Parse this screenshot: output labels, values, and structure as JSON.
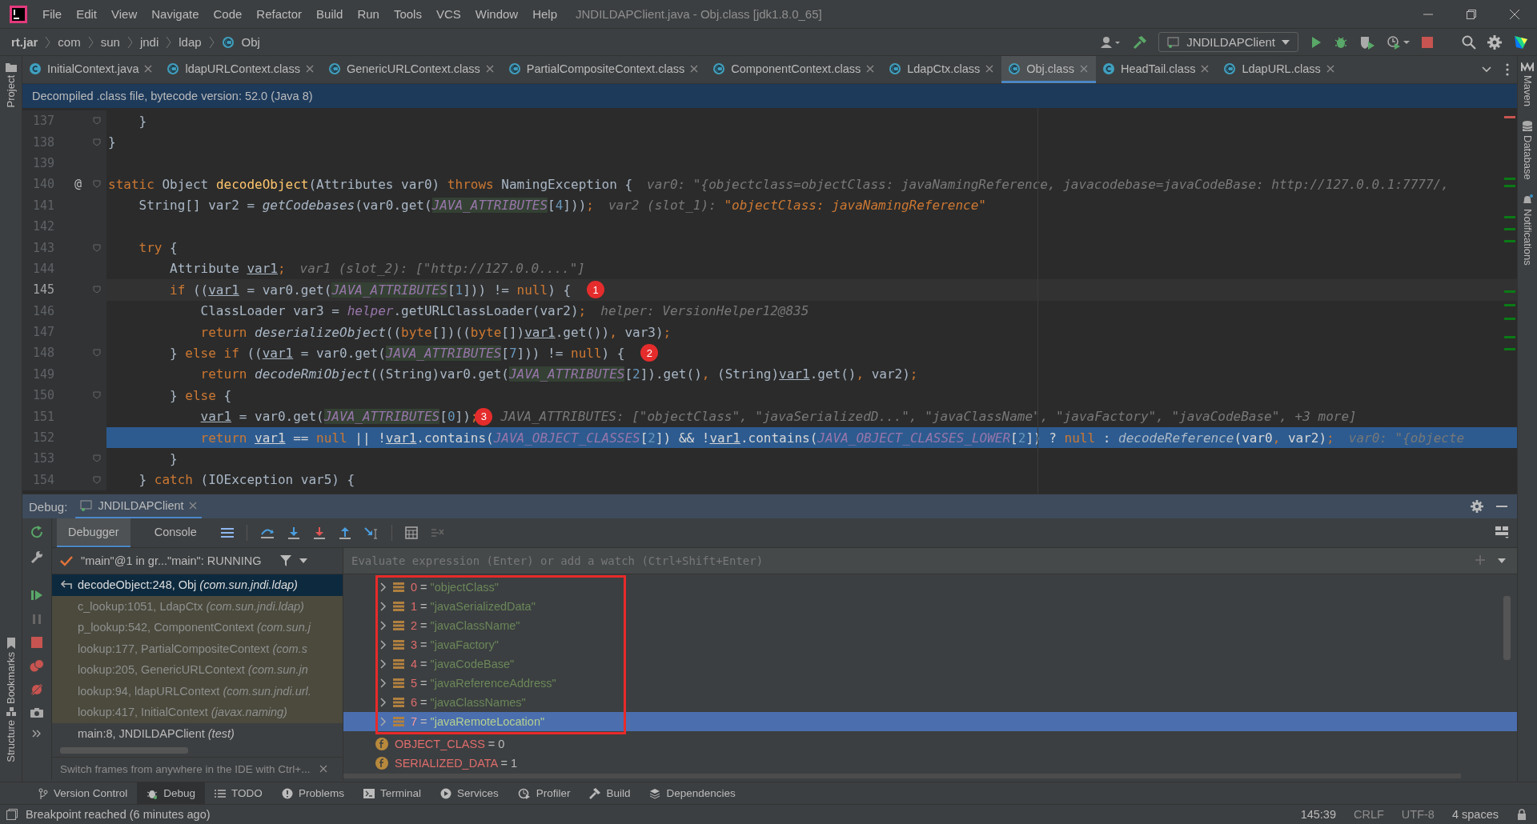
{
  "menu": [
    "File",
    "Edit",
    "View",
    "Navigate",
    "Code",
    "Refactor",
    "Build",
    "Run",
    "Tools",
    "VCS",
    "Window",
    "Help"
  ],
  "window_title": "JNDILDAPClient.java - Obj.class [jdk1.8.0_65]",
  "breadcrumb": [
    "rt.jar",
    "com",
    "sun",
    "jndi",
    "ldap",
    "Obj"
  ],
  "run_config": "JNDILDAPClient",
  "editor_tabs": [
    {
      "label": "InitialContext.java",
      "selected": false,
      "kind": "java"
    },
    {
      "label": "ldapURLContext.class",
      "selected": false,
      "kind": "compiled"
    },
    {
      "label": "GenericURLContext.class",
      "selected": false,
      "kind": "compiled"
    },
    {
      "label": "PartialCompositeContext.class",
      "selected": false,
      "kind": "compiled"
    },
    {
      "label": "ComponentContext.class",
      "selected": false,
      "kind": "compiled"
    },
    {
      "label": "LdapCtx.class",
      "selected": false,
      "kind": "compiled"
    },
    {
      "label": "Obj.class",
      "selected": true,
      "kind": "compiled"
    },
    {
      "label": "HeadTail.class",
      "selected": false,
      "kind": "java"
    },
    {
      "label": "LdapURL.class",
      "selected": false,
      "kind": "compiled"
    }
  ],
  "banner": "Decompiled .class file, bytecode version: 52.0 (Java 8)",
  "code_lines": [
    {
      "number": "137",
      "caret_line": false,
      "execution_point": false,
      "fold": true,
      "tokens": [
        {
          "text": "    }",
          "kind": "p"
        }
      ]
    },
    {
      "number": "138",
      "caret_line": false,
      "execution_point": false,
      "fold": true,
      "tokens": [
        {
          "text": "}",
          "kind": "p"
        }
      ]
    },
    {
      "number": "139",
      "caret_line": false,
      "execution_point": false,
      "fold": false
    },
    {
      "number": "140",
      "caret_line": false,
      "execution_point": false,
      "fold": true,
      "gutter_mark": "@",
      "tokens": [
        {
          "text": "static ",
          "kind": "k"
        },
        {
          "text": "Object ",
          "kind": "p"
        },
        {
          "text": "decodeObject",
          "kind": "d"
        },
        {
          "text": "(Attributes var0) ",
          "kind": "p"
        },
        {
          "text": "throws ",
          "kind": "k"
        },
        {
          "text": "NamingException {",
          "kind": "p"
        },
        {
          "text": "var0: \"{objectclass=objectClass: javaNamingReference, javacodebase=javaCodeBase: http://127.0.0.1:7777/,",
          "kind": "h"
        }
      ]
    },
    {
      "number": "141",
      "caret_line": false,
      "execution_point": false,
      "fold": false,
      "tokens": [
        {
          "text": "    String[] var2 = ",
          "kind": "p"
        },
        {
          "text": "getCodebases",
          "kind": "s"
        },
        {
          "text": "(var0.get(",
          "kind": "p"
        },
        {
          "text": "JAVA_ATTRIBUTES",
          "kind": "F"
        },
        {
          "text": "[",
          "kind": "p"
        },
        {
          "text": "4",
          "kind": "n"
        },
        {
          "text": "]))",
          "kind": "p"
        },
        {
          "text": ";",
          "kind": "k"
        },
        {
          "text": "var2 (slot_1): ",
          "kind": "h"
        },
        {
          "text": "\"objectClass: javaNamingReference\"",
          "kind": "hs"
        }
      ]
    },
    {
      "number": "142",
      "caret_line": false,
      "execution_point": false,
      "fold": false
    },
    {
      "number": "143",
      "caret_line": false,
      "execution_point": false,
      "fold": true,
      "tokens": [
        {
          "text": "    try ",
          "kind": "k"
        },
        {
          "text": "{",
          "kind": "p"
        }
      ]
    },
    {
      "number": "144",
      "caret_line": false,
      "execution_point": false,
      "fold": false,
      "tokens": [
        {
          "text": "        Attribute ",
          "kind": "p"
        },
        {
          "text": "var1",
          "kind": "v"
        },
        {
          "text": ";",
          "kind": "k"
        },
        {
          "text": "var1 (slot_2): [\"http://127.0.0....\"]",
          "kind": "h"
        }
      ]
    },
    {
      "number": "145",
      "caret_line": true,
      "execution_point": false,
      "fold": true,
      "tokens": [
        {
          "text": "        if ",
          "kind": "k"
        },
        {
          "text": "((",
          "kind": "p"
        },
        {
          "text": "var1",
          "kind": "v"
        },
        {
          "text": " = var0.get(",
          "kind": "p"
        },
        {
          "text": "JAVA_ATTRIBUTES",
          "kind": "F"
        },
        {
          "text": "[",
          "kind": "p"
        },
        {
          "text": "1",
          "kind": "n"
        },
        {
          "text": "])) != ",
          "kind": "p"
        },
        {
          "text": "null",
          "kind": "k"
        },
        {
          "text": ") {",
          "kind": "p"
        },
        {
          "text": "1",
          "kind": "badge"
        }
      ]
    },
    {
      "number": "146",
      "caret_line": false,
      "execution_point": false,
      "fold": false,
      "tokens": [
        {
          "text": "            ClassLoader var3 = ",
          "kind": "p"
        },
        {
          "text": "helper",
          "kind": "g"
        },
        {
          "text": ".getURLClassLoader(var2)",
          "kind": "p"
        },
        {
          "text": ";",
          "kind": "k"
        },
        {
          "text": "helper: VersionHelper12@835",
          "kind": "h"
        }
      ]
    },
    {
      "number": "147",
      "caret_line": false,
      "execution_point": false,
      "fold": false,
      "tokens": [
        {
          "text": "            return ",
          "kind": "k"
        },
        {
          "text": "deserializeObject",
          "kind": "s"
        },
        {
          "text": "((",
          "kind": "p"
        },
        {
          "text": "byte",
          "kind": "k"
        },
        {
          "text": "[])((",
          "kind": "p"
        },
        {
          "text": "byte",
          "kind": "k"
        },
        {
          "text": "[])",
          "kind": "p"
        },
        {
          "text": "var1",
          "kind": "v"
        },
        {
          "text": ".get())",
          "kind": "p"
        },
        {
          "text": ", ",
          "kind": "k"
        },
        {
          "text": "var3)",
          "kind": "p"
        },
        {
          "text": ";",
          "kind": "k"
        }
      ]
    },
    {
      "number": "148",
      "caret_line": false,
      "execution_point": false,
      "fold": true,
      "tokens": [
        {
          "text": "        } ",
          "kind": "p"
        },
        {
          "text": "else if ",
          "kind": "k"
        },
        {
          "text": "((",
          "kind": "p"
        },
        {
          "text": "var1",
          "kind": "v"
        },
        {
          "text": " = var0.get(",
          "kind": "p"
        },
        {
          "text": "JAVA_ATTRIBUTES",
          "kind": "F"
        },
        {
          "text": "[",
          "kind": "p"
        },
        {
          "text": "7",
          "kind": "n"
        },
        {
          "text": "])) != ",
          "kind": "p"
        },
        {
          "text": "null",
          "kind": "k"
        },
        {
          "text": ") {",
          "kind": "p"
        },
        {
          "text": "2",
          "kind": "badge"
        }
      ]
    },
    {
      "number": "149",
      "caret_line": false,
      "execution_point": false,
      "fold": false,
      "tokens": [
        {
          "text": "            return ",
          "kind": "k"
        },
        {
          "text": "decodeRmiObject",
          "kind": "s"
        },
        {
          "text": "((String)var0.get(",
          "kind": "p"
        },
        {
          "text": "JAVA_ATTRIBUTES",
          "kind": "F"
        },
        {
          "text": "[",
          "kind": "p"
        },
        {
          "text": "2",
          "kind": "n"
        },
        {
          "text": "]).get()",
          "kind": "p"
        },
        {
          "text": ", ",
          "kind": "k"
        },
        {
          "text": "(String)",
          "kind": "p"
        },
        {
          "text": "var1",
          "kind": "v"
        },
        {
          "text": ".get()",
          "kind": "p"
        },
        {
          "text": ", ",
          "kind": "k"
        },
        {
          "text": "var2)",
          "kind": "p"
        },
        {
          "text": ";",
          "kind": "k"
        }
      ]
    },
    {
      "number": "150",
      "caret_line": false,
      "execution_point": false,
      "fold": true,
      "tokens": [
        {
          "text": "        } ",
          "kind": "p"
        },
        {
          "text": "else ",
          "kind": "k"
        },
        {
          "text": "{",
          "kind": "p"
        }
      ]
    },
    {
      "number": "151",
      "caret_line": false,
      "execution_point": false,
      "fold": false,
      "tokens": [
        {
          "text": "            var1",
          "kind": "v"
        },
        {
          "text": " = var0.get(",
          "kind": "p"
        },
        {
          "text": "JAVA_ATTRIBUTES",
          "kind": "F"
        },
        {
          "text": "[",
          "kind": "p"
        },
        {
          "text": "0",
          "kind": "n"
        },
        {
          "text": "])",
          "kind": "p"
        },
        {
          "text": ";",
          "kind": "k"
        },
        {
          "text": "3",
          "kind": "badge"
        },
        {
          "text": "JAVA_ATTRIBUTES: [\"objectClass\", \"javaSerializedD...\", \"javaClassName\", \"javaFactory\", \"javaCodeBase\", +3 more]",
          "kind": "h"
        }
      ]
    },
    {
      "number": "152",
      "caret_line": false,
      "execution_point": true,
      "fold": false,
      "tokens": [
        {
          "text": "            return ",
          "kind": "k"
        },
        {
          "text": "var1",
          "kind": "v"
        },
        {
          "text": " == ",
          "kind": "p"
        },
        {
          "text": "null ",
          "kind": "k"
        },
        {
          "text": "|| !",
          "kind": "p"
        },
        {
          "text": "var1",
          "kind": "v"
        },
        {
          "text": ".contains(",
          "kind": "p"
        },
        {
          "text": "JAVA_OBJECT_CLASSES",
          "kind": "f"
        },
        {
          "text": "[",
          "kind": "p"
        },
        {
          "text": "2",
          "kind": "n"
        },
        {
          "text": "]) && !",
          "kind": "p"
        },
        {
          "text": "var1",
          "kind": "v"
        },
        {
          "text": ".contains(",
          "kind": "p"
        },
        {
          "text": "JAVA_OBJECT_CLASSES_LOWER",
          "kind": "f"
        },
        {
          "text": "[",
          "kind": "p"
        },
        {
          "text": "2",
          "kind": "n"
        },
        {
          "text": "]) ? ",
          "kind": "p"
        },
        {
          "text": "null ",
          "kind": "k"
        },
        {
          "text": ": ",
          "kind": "p"
        },
        {
          "text": "decodeReference",
          "kind": "s"
        },
        {
          "text": "(var0",
          "kind": "p"
        },
        {
          "text": ", ",
          "kind": "k"
        },
        {
          "text": "var2)",
          "kind": "p"
        },
        {
          "text": ";",
          "kind": "k"
        },
        {
          "text": "var0: \"{objecte",
          "kind": "h"
        }
      ]
    },
    {
      "number": "153",
      "caret_line": false,
      "execution_point": false,
      "fold": true,
      "tokens": [
        {
          "text": "        }",
          "kind": "p"
        }
      ]
    },
    {
      "number": "154",
      "caret_line": false,
      "execution_point": false,
      "fold": true,
      "tokens": [
        {
          "text": "    } ",
          "kind": "p"
        },
        {
          "text": "catch ",
          "kind": "k"
        },
        {
          "text": "(IOException var5) {",
          "kind": "p"
        }
      ]
    }
  ],
  "debug": {
    "title": "Debug:",
    "session": "JNDILDAPClient",
    "tabs": [
      {
        "label": "Debugger",
        "selected": true
      },
      {
        "label": "Console",
        "selected": false
      }
    ],
    "thread": "\"main\"@1 in gr...\"main\": RUNNING",
    "frames": [
      {
        "method": "decodeObject:248, Obj",
        "package": "(com.sun.jndi.ldap)",
        "selected": true,
        "library": false
      },
      {
        "method": "c_lookup:1051, LdapCtx",
        "package": "(com.sun.jndi.ldap)",
        "selected": false,
        "library": true
      },
      {
        "method": "p_lookup:542, ComponentContext",
        "package": "(com.sun.j",
        "selected": false,
        "library": true
      },
      {
        "method": "lookup:177, PartialCompositeContext",
        "package": "(com.s",
        "selected": false,
        "library": true
      },
      {
        "method": "lookup:205, GenericURLContext",
        "package": "(com.sun.jn",
        "selected": false,
        "library": true
      },
      {
        "method": "lookup:94, ldapURLContext",
        "package": "(com.sun.jndi.url.",
        "selected": false,
        "library": true
      },
      {
        "method": "lookup:417, InitialContext",
        "package": "(javax.naming)",
        "selected": false,
        "library": true
      },
      {
        "method": "main:8, JNDILDAPClient",
        "package": "(test)",
        "selected": false,
        "library": false
      }
    ],
    "frames_hint": "Switch frames from anywhere in the IDE with Ctrl+...",
    "evaluate_placeholder": "Evaluate expression (Enter) or add a watch (Ctrl+Shift+Enter)",
    "variables": [
      {
        "kind": "element",
        "name": "0",
        "operator": "=",
        "value": "\"objectClass\"",
        "selected": false
      },
      {
        "kind": "element",
        "name": "1",
        "operator": "=",
        "value": "\"javaSerializedData\"",
        "selected": false
      },
      {
        "kind": "element",
        "name": "2",
        "operator": "=",
        "value": "\"javaClassName\"",
        "selected": false
      },
      {
        "kind": "element",
        "name": "3",
        "operator": "=",
        "value": "\"javaFactory\"",
        "selected": false
      },
      {
        "kind": "element",
        "name": "4",
        "operator": "=",
        "value": "\"javaCodeBase\"",
        "selected": false
      },
      {
        "kind": "element",
        "name": "5",
        "operator": "=",
        "value": "\"javaReferenceAddress\"",
        "selected": false
      },
      {
        "kind": "element",
        "name": "6",
        "operator": "=",
        "value": "\"javaClassNames\"",
        "selected": false
      },
      {
        "kind": "element",
        "name": "7",
        "operator": "=",
        "value": "\"javaRemoteLocation\"",
        "selected": true
      },
      {
        "kind": "field",
        "name": "OBJECT_CLASS",
        "operator": "=",
        "value": "0",
        "selected": false
      },
      {
        "kind": "field",
        "name": "SERIALIZED_DATA",
        "operator": "=",
        "value": "1",
        "selected": false
      }
    ]
  },
  "tool_windows": [
    {
      "label": "Version Control",
      "selected": false
    },
    {
      "label": "Debug",
      "selected": true
    },
    {
      "label": "TODO",
      "selected": false
    },
    {
      "label": "Problems",
      "selected": false
    },
    {
      "label": "Terminal",
      "selected": false
    },
    {
      "label": "Services",
      "selected": false
    },
    {
      "label": "Profiler",
      "selected": false
    },
    {
      "label": "Build",
      "selected": false
    },
    {
      "label": "Dependencies",
      "selected": false
    }
  ],
  "left_strip": [
    "Project",
    "Bookmarks",
    "Structure"
  ],
  "right_strip": [
    "Maven",
    "Database",
    "Notifications"
  ],
  "status": {
    "message": "Breakpoint reached (6 minutes ago)",
    "position": "145:39",
    "line_separator": "CRLF",
    "encoding": "UTF-8",
    "indent": "4 spaces"
  }
}
